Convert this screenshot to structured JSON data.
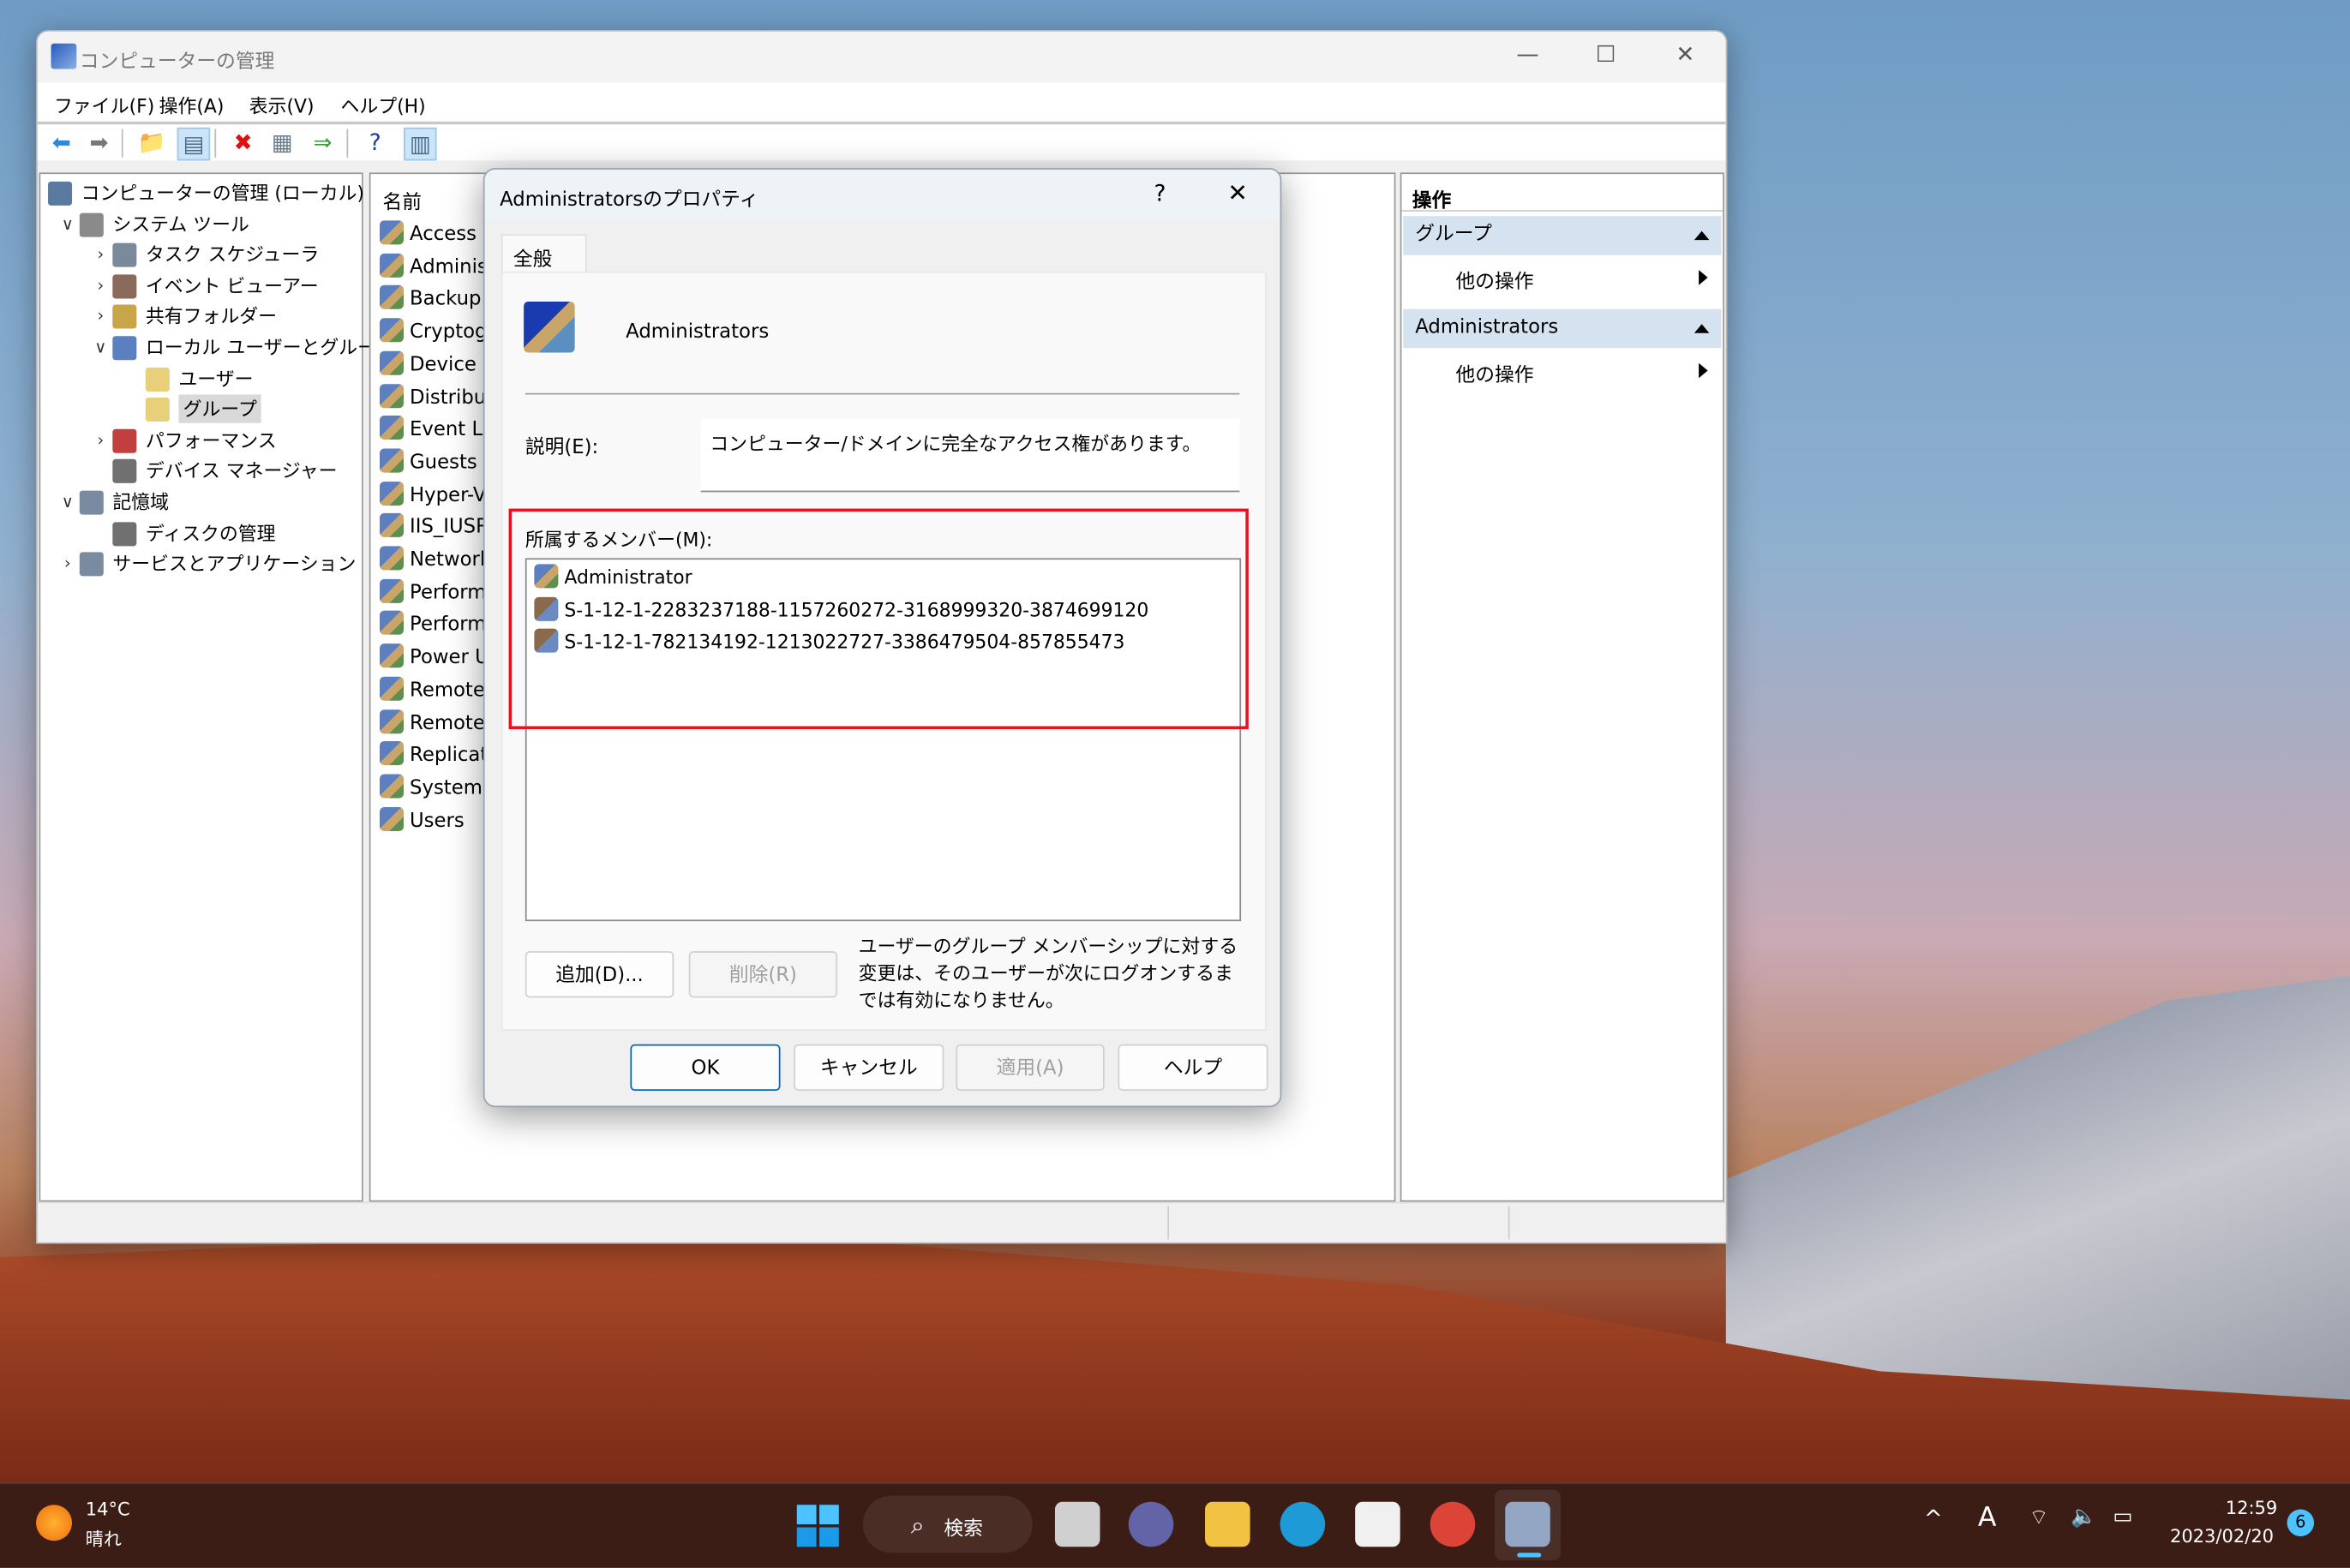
{
  "window": {
    "title": "コンピューターの管理",
    "minimize": "—",
    "maximize": "☐",
    "close": "✕"
  },
  "menubar": [
    "ファイル(F)",
    "操作(A)",
    "表示(V)",
    "ヘルプ(H)"
  ],
  "toolbar": [
    {
      "icon": "back-arrow-icon",
      "glyph": "⬅",
      "color": "#2a8ae0"
    },
    {
      "icon": "forward-arrow-icon",
      "glyph": "➡",
      "color": "#777"
    },
    {
      "icon": "up-folder-icon",
      "glyph": "📁",
      "color": "#c9a54a"
    },
    {
      "icon": "show-hide-tree-icon",
      "glyph": "▤",
      "color": "#4a6a8a",
      "selected": true
    },
    {
      "icon": "delete-icon",
      "glyph": "✖",
      "color": "#e01010"
    },
    {
      "icon": "properties-icon",
      "glyph": "▦",
      "color": "#6a7a8a"
    },
    {
      "icon": "export-list-icon",
      "glyph": "⇒",
      "color": "#3a9a3a"
    },
    {
      "icon": "help-icon",
      "glyph": "?",
      "color": "#1a3aa0"
    },
    {
      "icon": "show-action-pane-icon",
      "glyph": "▥",
      "color": "#4a6a8a",
      "selected": true
    }
  ],
  "tree": [
    {
      "label": "コンピューターの管理 (ローカル)",
      "level": 0,
      "chevron": "",
      "color": "#5a7aa0"
    },
    {
      "label": "システム ツール",
      "level": 1,
      "chevron": "∨",
      "color": "#8a8a8a"
    },
    {
      "label": "タスク スケジューラ",
      "level": 2,
      "chevron": "›",
      "color": "#7a8a9a"
    },
    {
      "label": "イベント ビューアー",
      "level": 2,
      "chevron": "›",
      "color": "#8a6a5a"
    },
    {
      "label": "共有フォルダー",
      "level": 2,
      "chevron": "›",
      "color": "#c9a54a"
    },
    {
      "label": "ローカル ユーザーとグループ",
      "level": 2,
      "chevron": "∨",
      "color": "#5b7fbf"
    },
    {
      "label": "ユーザー",
      "level": 3,
      "chevron": "",
      "color": "#e8cf7a"
    },
    {
      "label": "グループ",
      "level": 3,
      "chevron": "",
      "color": "#e8cf7a",
      "selected": true
    },
    {
      "label": "パフォーマンス",
      "level": 2,
      "chevron": "›",
      "color": "#c04040"
    },
    {
      "label": "デバイス マネージャー",
      "level": 2,
      "chevron": "",
      "color": "#707070"
    },
    {
      "label": "記憶域",
      "level": 1,
      "chevron": "∨",
      "color": "#7a8aa0"
    },
    {
      "label": "ディスクの管理",
      "level": 2,
      "chevron": "",
      "color": "#707070"
    },
    {
      "label": "サービスとアプリケーション",
      "level": 1,
      "chevron": "›",
      "color": "#7a8aa0"
    }
  ],
  "list": {
    "header": "名前",
    "items": [
      "Access C",
      "Administ",
      "Backup (",
      "Cryptogr",
      "Device C",
      "Distribut",
      "Event Lo",
      "Guests",
      "Hyper-V",
      "IIS_IUSRS",
      "Network",
      "Performa",
      "Performa",
      "Power Us",
      "Remote",
      "Remote",
      "Replicato",
      "System M",
      "Users"
    ]
  },
  "actions": {
    "header": "操作",
    "sections": [
      {
        "title": "グループ",
        "item": "他の操作"
      },
      {
        "title": "Administrators",
        "item": "他の操作"
      }
    ]
  },
  "dialog": {
    "title": "Administratorsのプロパティ",
    "help": "?",
    "close": "✕",
    "tab": "全般",
    "group_name": "Administrators",
    "description_label": "説明(E):",
    "description": "コンピューター/ドメインに完全なアクセス権があります。",
    "members_label": "所属するメンバー(M):",
    "members": [
      {
        "name": "Administrator",
        "icon": "user-icon"
      },
      {
        "name": "S-1-12-1-2283237188-1157260272-3168999320-3874699120",
        "icon": "unknown-user-icon"
      },
      {
        "name": "S-1-12-1-782134192-1213022727-3386479504-857855473",
        "icon": "unknown-user-icon"
      }
    ],
    "add": "追加(D)...",
    "remove": "削除(R)",
    "note": "ユーザーのグループ メンバーシップに対する変更は、そのユーザーが次にログオンするまでは有効になりません。",
    "ok": "OK",
    "cancel": "キャンセル",
    "apply": "適用(A)",
    "helpbtn": "ヘルプ",
    "highlight_color": "#e81123"
  },
  "taskbar": {
    "temp": "14°C",
    "weather": "晴れ",
    "search": "検索",
    "ime": "A",
    "time": "12:59",
    "date": "2023/02/20",
    "badge": "6",
    "apps": [
      {
        "name": "task-view",
        "color": "#d0d0d0"
      },
      {
        "name": "teams",
        "color": "#6264a7"
      },
      {
        "name": "file-explorer",
        "color": "#f2c343"
      },
      {
        "name": "edge",
        "color": "#1e9bd6"
      },
      {
        "name": "store",
        "color": "#f0f0f0"
      },
      {
        "name": "chrome",
        "color": "#db4437"
      },
      {
        "name": "computer-management",
        "color": "#8aa0c0"
      }
    ]
  }
}
